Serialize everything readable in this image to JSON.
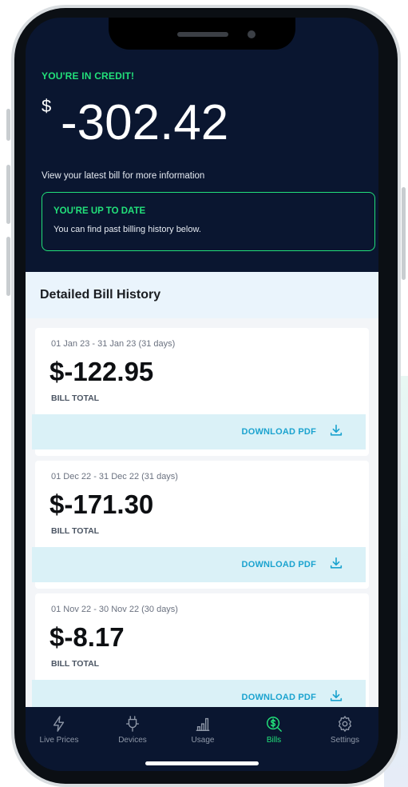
{
  "balance": {
    "heading": "YOU'RE IN CREDIT!",
    "currency_symbol": "$",
    "amount": "-302.42",
    "info": "View your latest bill for more information"
  },
  "status": {
    "title": "YOU'RE UP TO DATE",
    "text": "You can find past billing history below."
  },
  "history": {
    "title": "Detailed Bill History",
    "bills": [
      {
        "period": "01 Jan 23 - 31 Jan 23 (31 days)",
        "amount": "$-122.95",
        "label": "BILL TOTAL",
        "download": "DOWNLOAD PDF"
      },
      {
        "period": "01 Dec 22 - 31 Dec 22 (31 days)",
        "amount": "$-171.30",
        "label": "BILL TOTAL",
        "download": "DOWNLOAD PDF"
      },
      {
        "period": "01 Nov 22 - 30 Nov 22 (30 days)",
        "amount": "$-8.17",
        "label": "BILL TOTAL",
        "download": "DOWNLOAD PDF"
      }
    ]
  },
  "tabs": [
    {
      "label": "Live Prices",
      "icon": "lightning-icon"
    },
    {
      "label": "Devices",
      "icon": "plug-icon"
    },
    {
      "label": "Usage",
      "icon": "bar-chart-icon"
    },
    {
      "label": "Bills",
      "icon": "dollar-search-icon",
      "active": true
    },
    {
      "label": "Settings",
      "icon": "gear-icon"
    }
  ],
  "colors": {
    "screen_bg": "#0a1630",
    "accent_green": "#22e07a",
    "download_blue": "#1ba3cf",
    "download_bar": "#daf1f7"
  }
}
